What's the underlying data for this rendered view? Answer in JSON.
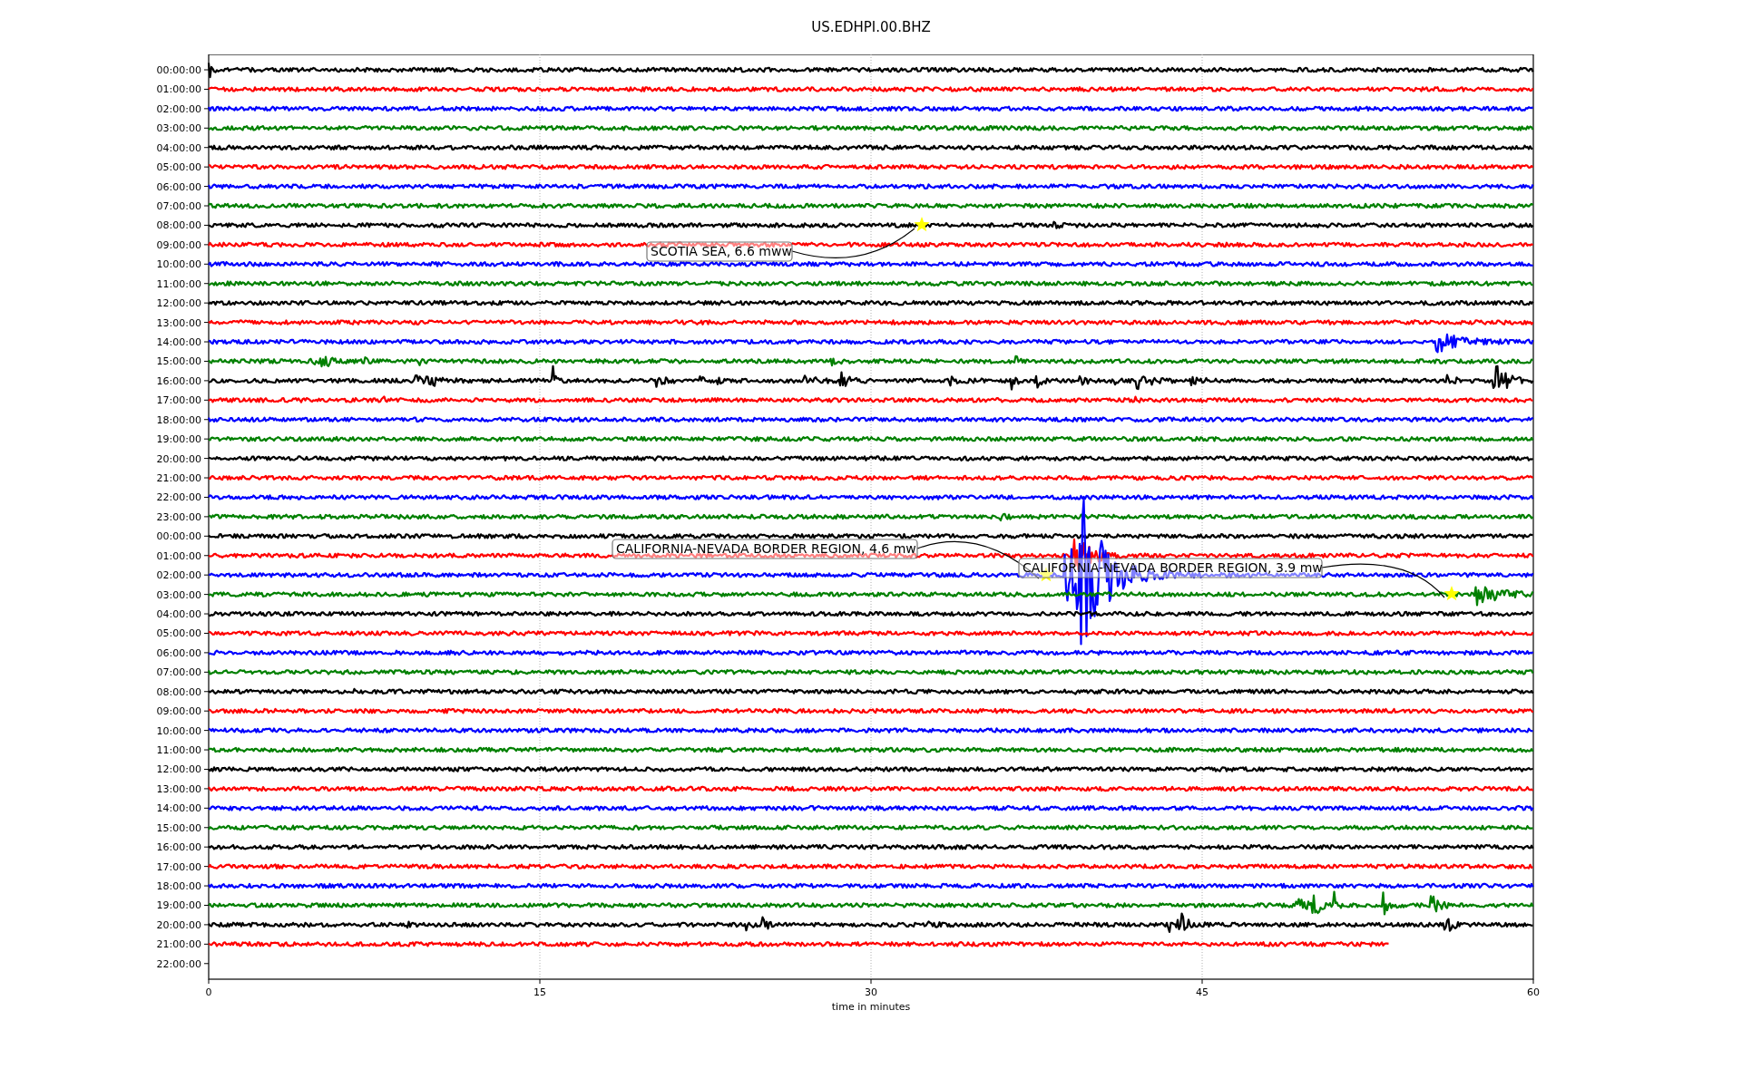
{
  "title": "US.EDHPI.00.BHZ",
  "xlabel": "time in minutes",
  "xticks": [
    "0",
    "15",
    "30",
    "45",
    "60"
  ],
  "rows": [
    {
      "label": "00:00:00",
      "color": "#000000"
    },
    {
      "label": "01:00:00",
      "color": "#ff0000"
    },
    {
      "label": "02:00:00",
      "color": "#0000ff"
    },
    {
      "label": "03:00:00",
      "color": "#008000"
    },
    {
      "label": "04:00:00",
      "color": "#000000"
    },
    {
      "label": "05:00:00",
      "color": "#ff0000"
    },
    {
      "label": "06:00:00",
      "color": "#0000ff"
    },
    {
      "label": "07:00:00",
      "color": "#008000"
    },
    {
      "label": "08:00:00",
      "color": "#000000"
    },
    {
      "label": "09:00:00",
      "color": "#ff0000"
    },
    {
      "label": "10:00:00",
      "color": "#0000ff"
    },
    {
      "label": "11:00:00",
      "color": "#008000"
    },
    {
      "label": "12:00:00",
      "color": "#000000"
    },
    {
      "label": "13:00:00",
      "color": "#ff0000"
    },
    {
      "label": "14:00:00",
      "color": "#0000ff"
    },
    {
      "label": "15:00:00",
      "color": "#008000"
    },
    {
      "label": "16:00:00",
      "color": "#000000"
    },
    {
      "label": "17:00:00",
      "color": "#ff0000"
    },
    {
      "label": "18:00:00",
      "color": "#0000ff"
    },
    {
      "label": "19:00:00",
      "color": "#008000"
    },
    {
      "label": "20:00:00",
      "color": "#000000"
    },
    {
      "label": "21:00:00",
      "color": "#ff0000"
    },
    {
      "label": "22:00:00",
      "color": "#0000ff"
    },
    {
      "label": "23:00:00",
      "color": "#008000"
    },
    {
      "label": "00:00:00",
      "color": "#000000"
    },
    {
      "label": "01:00:00",
      "color": "#ff0000"
    },
    {
      "label": "02:00:00",
      "color": "#0000ff"
    },
    {
      "label": "03:00:00",
      "color": "#008000"
    },
    {
      "label": "04:00:00",
      "color": "#000000"
    },
    {
      "label": "05:00:00",
      "color": "#ff0000"
    },
    {
      "label": "06:00:00",
      "color": "#0000ff"
    },
    {
      "label": "07:00:00",
      "color": "#008000"
    },
    {
      "label": "08:00:00",
      "color": "#000000"
    },
    {
      "label": "09:00:00",
      "color": "#ff0000"
    },
    {
      "label": "10:00:00",
      "color": "#0000ff"
    },
    {
      "label": "11:00:00",
      "color": "#008000"
    },
    {
      "label": "12:00:00",
      "color": "#000000"
    },
    {
      "label": "13:00:00",
      "color": "#ff0000"
    },
    {
      "label": "14:00:00",
      "color": "#0000ff"
    },
    {
      "label": "15:00:00",
      "color": "#008000"
    },
    {
      "label": "16:00:00",
      "color": "#000000"
    },
    {
      "label": "17:00:00",
      "color": "#ff0000"
    },
    {
      "label": "18:00:00",
      "color": "#0000ff"
    },
    {
      "label": "19:00:00",
      "color": "#008000"
    },
    {
      "label": "20:00:00",
      "color": "#000000"
    },
    {
      "label": "21:00:00",
      "color": "#ff0000"
    },
    {
      "label": "22:00:00"
    }
  ],
  "annotations": [
    {
      "text": "SCOTIA SEA, 6.6 mww"
    },
    {
      "text": "CALIFORNIA-NEVADA BORDER REGION, 4.6 mw"
    },
    {
      "text": "CALIFORNIA-NEVADA BORDER REGION, 3.9 mw"
    }
  ]
}
